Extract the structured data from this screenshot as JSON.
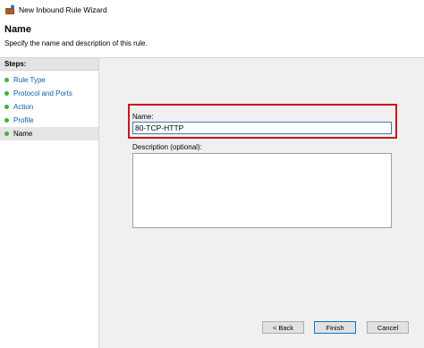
{
  "window": {
    "title": "New Inbound Rule Wizard",
    "icon": "firewall-wizard-icon"
  },
  "header": {
    "heading": "Name",
    "description": "Specify the name and description of this rule."
  },
  "steps": {
    "heading": "Steps:",
    "items": [
      {
        "label": "Rule Type",
        "current": false
      },
      {
        "label": "Protocol and Ports",
        "current": false
      },
      {
        "label": "Action",
        "current": false
      },
      {
        "label": "Profile",
        "current": false
      },
      {
        "label": "Name",
        "current": true
      }
    ]
  },
  "form": {
    "name_label": "Name:",
    "name_value": "80-TCP-HTTP",
    "description_label": "Description (optional):",
    "description_value": ""
  },
  "buttons": {
    "back": "< Back",
    "finish": "Finish",
    "cancel": "Cancel"
  },
  "colors": {
    "highlight": "#c8161d",
    "step_dot": "#3db33d",
    "step_link": "#0f5fa8"
  }
}
